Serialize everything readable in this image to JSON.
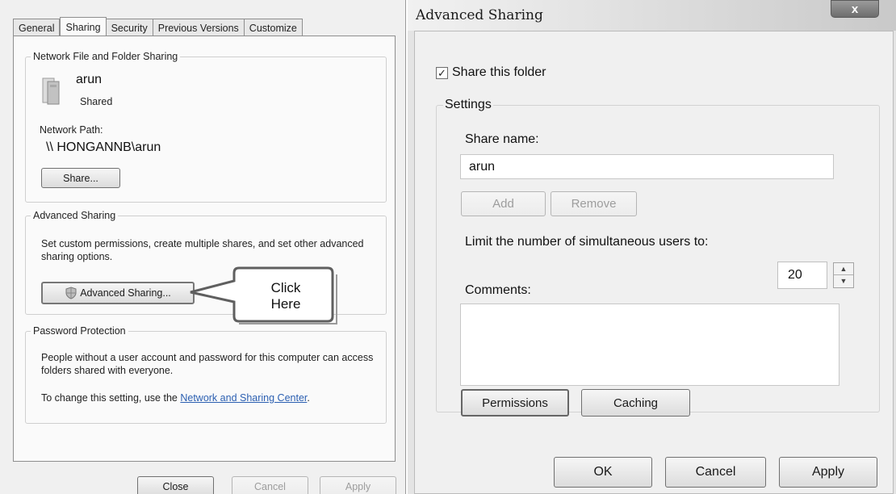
{
  "properties_dialog": {
    "tabs": [
      "General",
      "Sharing",
      "Security",
      "Previous Versions",
      "Customize"
    ],
    "active_tab": "Sharing",
    "network_sharing": {
      "legend": "Network File and Folder Sharing",
      "folder_name": "arun",
      "status": "Shared",
      "network_path_label": "Network Path:",
      "network_path": "\\\\ HONGANNB\\arun",
      "share_button": "Share..."
    },
    "advanced_sharing": {
      "legend": "Advanced Sharing",
      "description": "Set custom permissions, create multiple shares, and set other advanced sharing options.",
      "button": "Advanced Sharing..."
    },
    "password_protection": {
      "legend": "Password Protection",
      "description": "People without a user account and password for this computer can access folders shared with everyone.",
      "change_prefix": "To change this setting, use the ",
      "link": "Network and Sharing Center",
      "change_suffix": "."
    },
    "buttons": {
      "close": "Close",
      "cancel": "Cancel",
      "apply": "Apply"
    }
  },
  "callout": {
    "line1": "Click",
    "line2": "Here"
  },
  "advanced_sharing_dialog": {
    "title": "Advanced Sharing",
    "close_glyph": "x",
    "share_checkbox_label": "Share this folder",
    "share_checked": true,
    "settings_legend": "Settings",
    "share_name_label": "Share name:",
    "share_name_value": "arun",
    "add_button": "Add",
    "remove_button": "Remove",
    "limit_label": "Limit the number of simultaneous users to:",
    "limit_value": "20",
    "comments_label": "Comments:",
    "permissions_button": "Permissions",
    "caching_button": "Caching",
    "ok_button": "OK",
    "cancel_button": "Cancel",
    "apply_button": "Apply"
  }
}
